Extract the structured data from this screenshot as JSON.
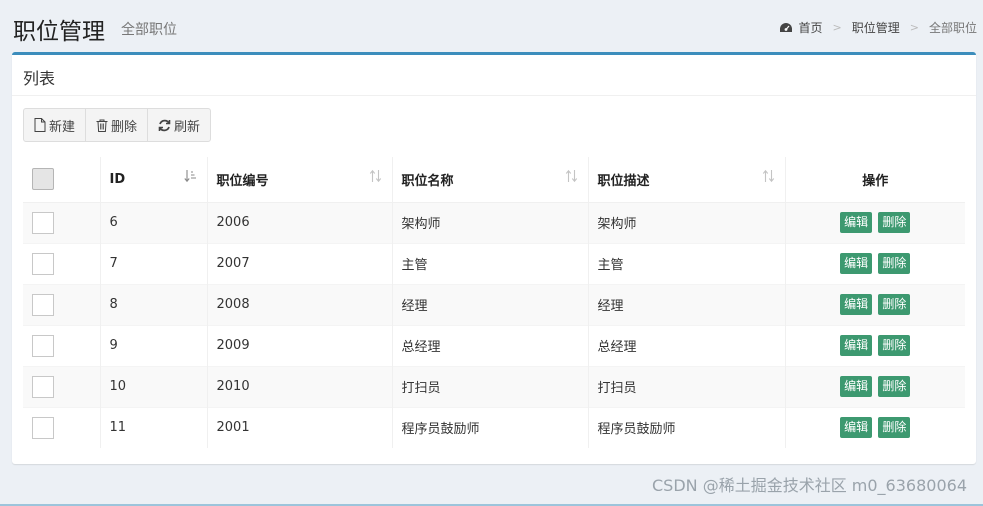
{
  "header": {
    "title": "职位管理",
    "subtitle": "全部职位",
    "breadcrumb": [
      "首页",
      "职位管理",
      "全部职位"
    ]
  },
  "box": {
    "title": "列表"
  },
  "toolbar": {
    "new_label": "新建",
    "delete_label": "删除",
    "refresh_label": "刷新"
  },
  "table": {
    "headers": {
      "id": "ID",
      "code": "职位编号",
      "name": "职位名称",
      "desc": "职位描述",
      "ops": "操作"
    },
    "rows": [
      {
        "id": "6",
        "code": "2006",
        "name": "架构师",
        "desc": "架构师"
      },
      {
        "id": "7",
        "code": "2007",
        "name": "主管",
        "desc": "主管"
      },
      {
        "id": "8",
        "code": "2008",
        "name": "经理",
        "desc": "经理"
      },
      {
        "id": "9",
        "code": "2009",
        "name": "总经理",
        "desc": "总经理"
      },
      {
        "id": "10",
        "code": "2010",
        "name": "打扫员",
        "desc": "打扫员"
      },
      {
        "id": "11",
        "code": "2001",
        "name": "程序员鼓励师",
        "desc": "程序员鼓励师"
      }
    ],
    "edit_label": "编辑",
    "delete_label": "删除"
  },
  "watermark": "CSDN @稀土掘金技术社区 m0_63680064",
  "colors": {
    "accent": "#3c8dbc",
    "op_button": "#3d9970",
    "background": "#ecf0f5"
  },
  "icons": {
    "breadcrumb": "dashboard-icon",
    "new": "file-icon",
    "delete": "trash-icon",
    "refresh": "refresh-icon",
    "sort": "sort-icon"
  }
}
